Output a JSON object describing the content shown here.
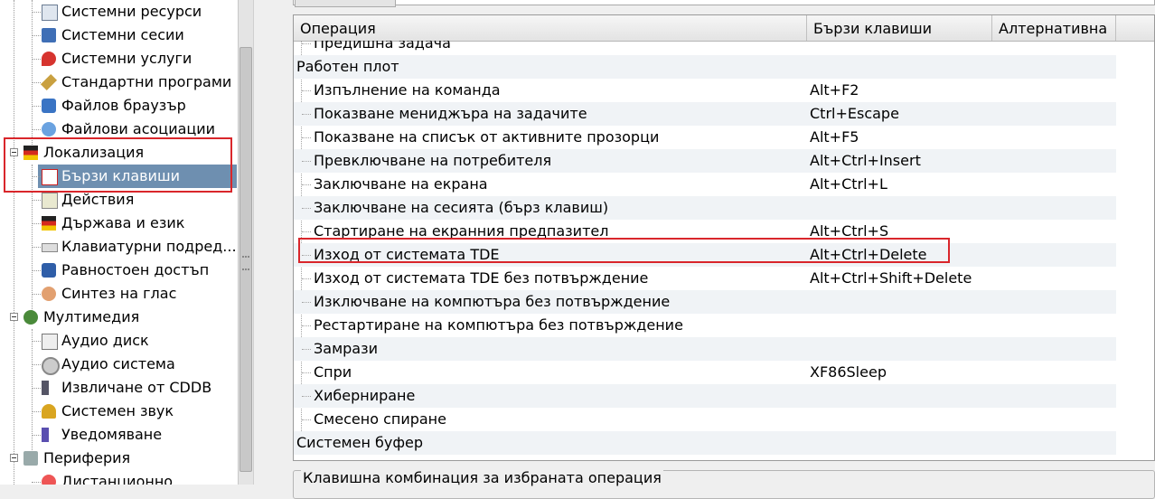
{
  "sidebar": {
    "items": [
      {
        "label": "Системни ресурси",
        "icon": "system-resources-icon"
      },
      {
        "label": "Системни сесии",
        "icon": "system-sessions-icon"
      },
      {
        "label": "Системни услуги",
        "icon": "system-services-icon"
      },
      {
        "label": "Стандартни програми",
        "icon": "default-apps-icon"
      },
      {
        "label": "Файлов браузър",
        "icon": "file-browser-icon"
      },
      {
        "label": "Файлови асоциации",
        "icon": "file-associations-icon"
      },
      {
        "label": "Локализация",
        "icon": "localization-flag-icon",
        "expanded": true
      },
      {
        "label": "Бързи клавиши",
        "icon": "shortcuts-icon",
        "selected": true
      },
      {
        "label": "Действия",
        "icon": "actions-icon"
      },
      {
        "label": "Държава и език",
        "icon": "country-language-icon"
      },
      {
        "label": "Клавиатурни подред...",
        "icon": "keyboard-layout-icon"
      },
      {
        "label": "Равностоен достъп",
        "icon": "accessibility-icon"
      },
      {
        "label": "Синтез на глас",
        "icon": "speech-synthesis-icon"
      },
      {
        "label": "Мултимедия",
        "icon": "multimedia-icon",
        "expanded": true
      },
      {
        "label": "Аудио диск",
        "icon": "audio-cd-icon"
      },
      {
        "label": "Аудио система",
        "icon": "audio-system-icon"
      },
      {
        "label": "Извличане от CDDB",
        "icon": "cddb-icon"
      },
      {
        "label": "Системен звук",
        "icon": "system-bell-icon"
      },
      {
        "label": "Уведомяване",
        "icon": "notification-icon"
      },
      {
        "label": "Периферия",
        "icon": "peripherals-icon",
        "expanded": true
      },
      {
        "label": "Дистанционно",
        "icon": "remote-icon"
      }
    ]
  },
  "table": {
    "columns": [
      "Операция",
      "Бързи клавиши",
      "Алтернативна"
    ],
    "rows": [
      {
        "op": "Предишна задача",
        "key": "",
        "alt": "",
        "group": false
      },
      {
        "op": "Работен плот",
        "key": "",
        "alt": "",
        "group": true
      },
      {
        "op": "Изпълнение на команда",
        "key": "Alt+F2",
        "alt": "",
        "group": false
      },
      {
        "op": "Показване мениджъра на задачите",
        "key": "Ctrl+Escape",
        "alt": "",
        "group": false
      },
      {
        "op": "Показване на списък от активните прозорци",
        "key": "Alt+F5",
        "alt": "",
        "group": false
      },
      {
        "op": "Превключване на потребителя",
        "key": "Alt+Ctrl+Insert",
        "alt": "",
        "group": false
      },
      {
        "op": "Заключване на екрана",
        "key": "Alt+Ctrl+L",
        "alt": "",
        "group": false
      },
      {
        "op": "Заключване на сесията (бърз клавиш)",
        "key": "",
        "alt": "",
        "group": false
      },
      {
        "op": "Стартиране на екранния предпазител",
        "key": "Alt+Ctrl+S",
        "alt": "",
        "group": false
      },
      {
        "op": "Изход от системата TDE",
        "key": "Alt+Ctrl+Delete",
        "alt": "",
        "group": false
      },
      {
        "op": "Изход от системата TDE без потвърждение",
        "key": "Alt+Ctrl+Shift+Delete",
        "alt": "",
        "group": false
      },
      {
        "op": "Изключване на компютъра без потвърждение",
        "key": "",
        "alt": "",
        "group": false
      },
      {
        "op": "Рестартиране на компютъра без потвърждение",
        "key": "",
        "alt": "",
        "group": false
      },
      {
        "op": "Замрази",
        "key": "",
        "alt": "",
        "group": false
      },
      {
        "op": "Спри",
        "key": "XF86Sleep",
        "alt": "",
        "group": false
      },
      {
        "op": "Хиберниране",
        "key": "",
        "alt": "",
        "group": false
      },
      {
        "op": "Смесено спиране",
        "key": "",
        "alt": "",
        "group": false
      },
      {
        "op": "Системен буфер",
        "key": "",
        "alt": "",
        "group": true
      },
      {
        "op": "",
        "key": "",
        "alt": "",
        "group": false
      }
    ]
  },
  "groupbox": {
    "title": "Клавишна комбинация за избраната операция"
  },
  "colors": {
    "selection": "#6e8fb0",
    "highlight": "#d9262b",
    "alt_row": "#f0f3f6"
  }
}
